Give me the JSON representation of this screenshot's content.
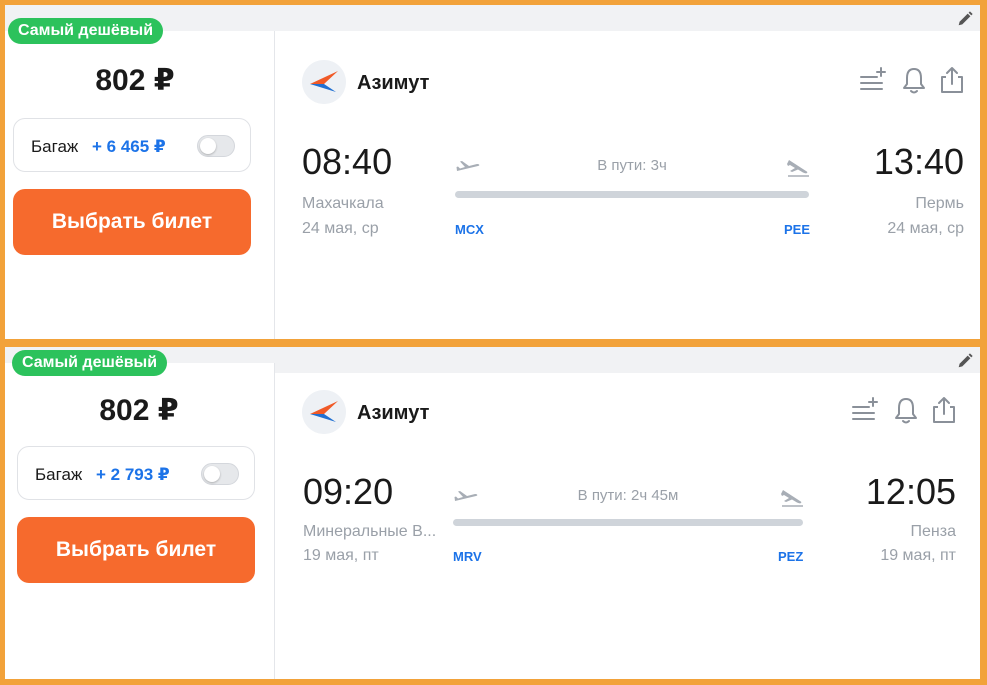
{
  "colors": {
    "frame": "#f2a23a",
    "badge": "#2cc25c",
    "button": "#f66a2d",
    "link": "#1c73e8",
    "muted": "#9aa0a8"
  },
  "tickets": [
    {
      "badge": "Самый дешёвый",
      "price": "802 ₽",
      "baggage_label": "Багаж",
      "baggage_extra": "+ 6 465 ₽",
      "baggage_enabled": false,
      "buy_label": "Выбрать билет",
      "airline": "Азимут",
      "departure": {
        "time": "08:40",
        "city": "Махачкала",
        "date": "24 мая, ср",
        "code": "MCX"
      },
      "arrival": {
        "time": "13:40",
        "city": "Пермь",
        "date": "24 мая, ср",
        "code": "PEE"
      },
      "duration": "В пути: 3ч"
    },
    {
      "badge": "Самый дешёвый",
      "price": "802 ₽",
      "baggage_label": "Багаж",
      "baggage_extra": "+ 2 793 ₽",
      "baggage_enabled": false,
      "buy_label": "Выбрать билет",
      "airline": "Азимут",
      "departure": {
        "time": "09:20",
        "city": "Минеральные В...",
        "date": "19 мая, пт",
        "code": "MRV"
      },
      "arrival": {
        "time": "12:05",
        "city": "Пенза",
        "date": "19 мая, пт",
        "code": "PEZ"
      },
      "duration": "В пути: 2ч 45м"
    }
  ],
  "icons": {
    "edit": "pencil-icon",
    "add_to_list": "add-to-list-icon",
    "subscribe": "bell-icon",
    "share": "share-icon",
    "takeoff": "plane-takeoff-icon",
    "landing": "plane-landing-icon",
    "airline_logo": "azimut-logo"
  }
}
